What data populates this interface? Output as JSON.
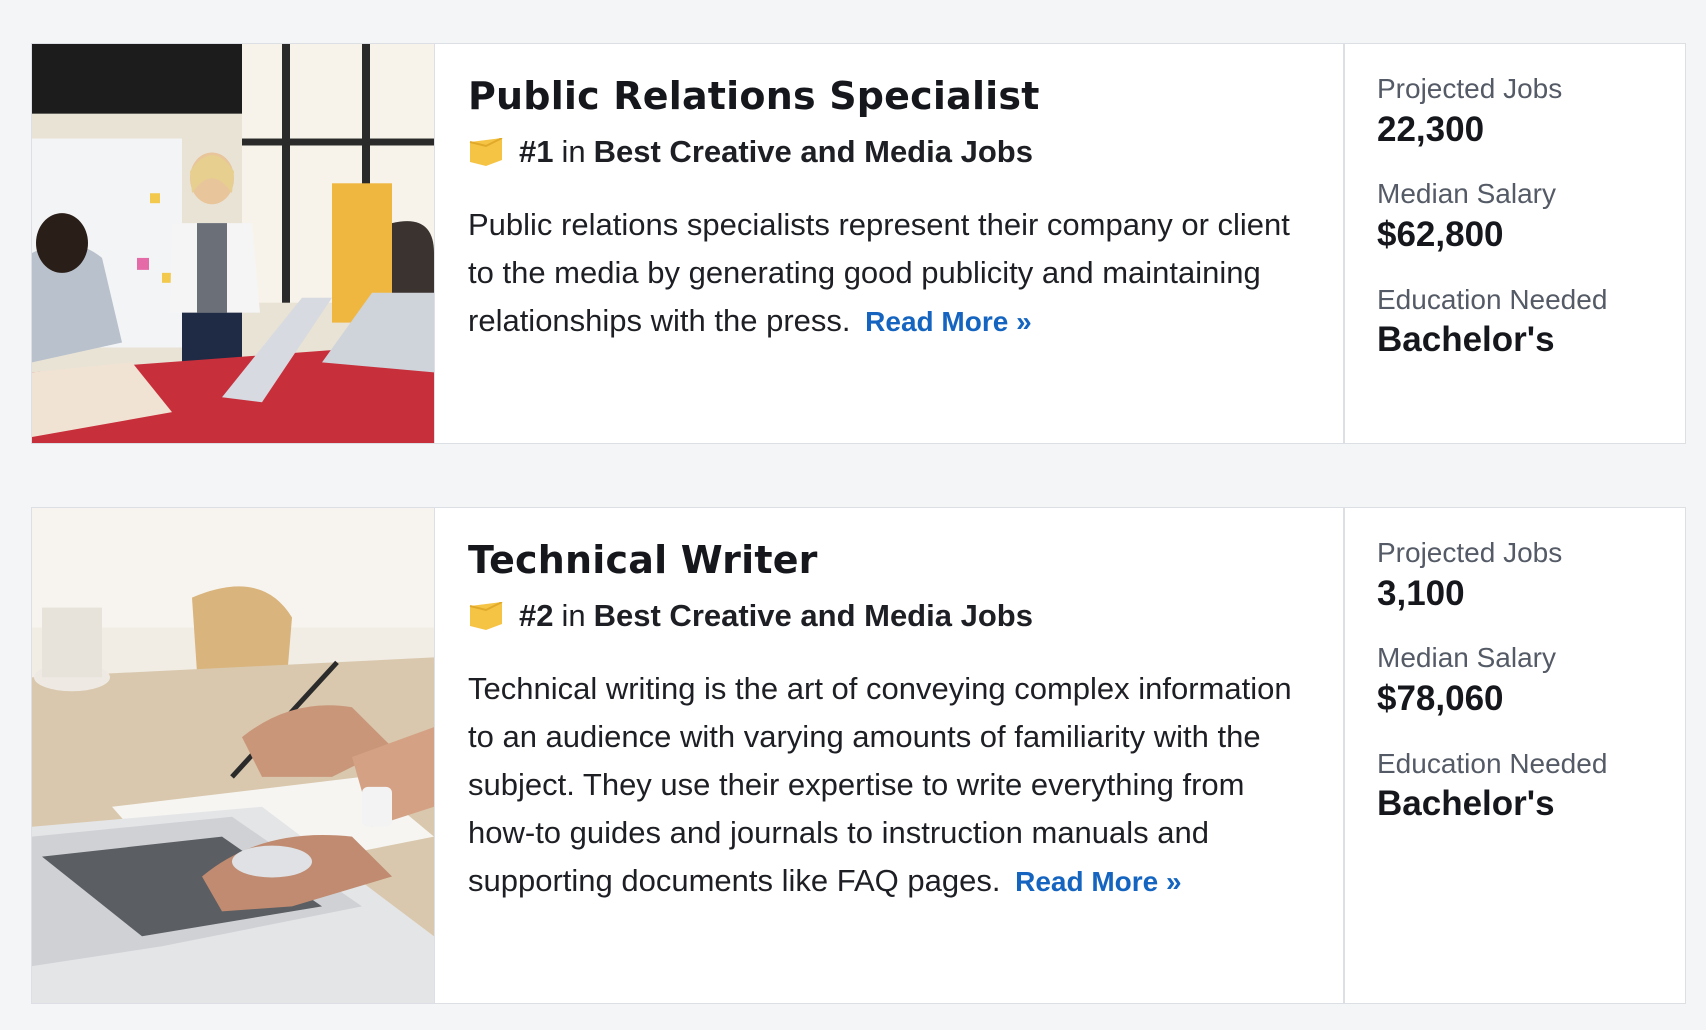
{
  "jobs": [
    {
      "title": "Public Relations Specialist",
      "rank": "#1",
      "rank_in": "in",
      "rank_list": "Best Creative and Media Jobs",
      "description": "Public relations specialists represent their company or client to the media by generating good publicity and maintaining relationships with the press.",
      "read_more": "Read More »",
      "stats": {
        "projected_jobs_label": "Projected Jobs",
        "projected_jobs": "22,300",
        "median_salary_label": "Median Salary",
        "median_salary": "$62,800",
        "education_label": "Education Needed",
        "education": "Bachelor's"
      }
    },
    {
      "title": "Technical Writer",
      "rank": "#2",
      "rank_in": "in",
      "rank_list": "Best Creative and Media Jobs",
      "description": "Technical writing is the art of conveying complex information to an audience with varying amounts of familiarity with the subject. They use their expertise to write everything from how-to guides and journals to instruction manuals and supporting documents like FAQ pages.",
      "read_more": "Read More »",
      "stats": {
        "projected_jobs_label": "Projected Jobs",
        "projected_jobs": "3,100",
        "median_salary_label": "Median Salary",
        "median_salary": "$78,060",
        "education_label": "Education Needed",
        "education": "Bachelor's"
      }
    }
  ],
  "colors": {
    "link": "#1565c0",
    "badge": "#f6c445",
    "background": "#f4f5f7"
  },
  "icons": {
    "badge": "ribbon-badge-icon"
  }
}
